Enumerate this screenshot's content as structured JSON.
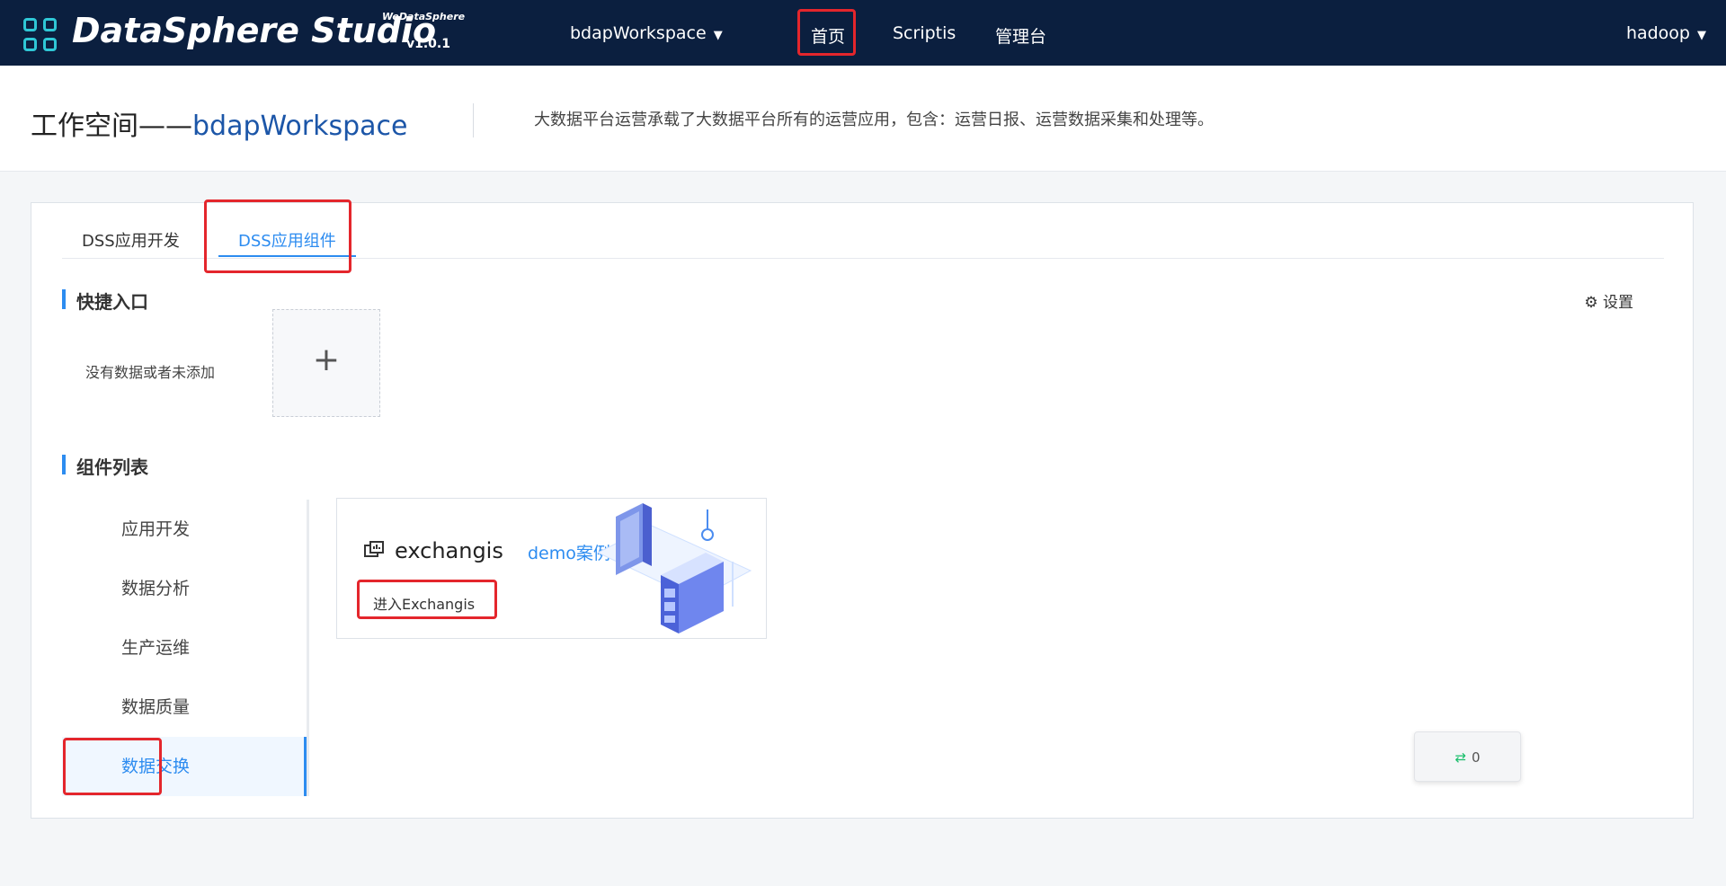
{
  "brand": {
    "name": "DataSphere Studio",
    "sub": "WeDataSphere",
    "version": "v1.0.1"
  },
  "topnav": {
    "workspace": "bdapWorkspace",
    "items": [
      "首页",
      "Scriptis",
      "管理台"
    ],
    "user": "hadoop"
  },
  "workspace_header": {
    "title_prefix": "工作空间——",
    "title_name": "bdapWorkspace",
    "description": "大数据平台运营承载了大数据平台所有的运营应用，包含：运营日报、运营数据采集和处理等。"
  },
  "tabs": [
    "DSS应用开发",
    "DSS应用组件"
  ],
  "quick_entry": {
    "title": "快捷入口",
    "settings_label": "设置",
    "empty_text": "没有数据或者未添加",
    "add_symbol": "+"
  },
  "component_list": {
    "title": "组件列表",
    "items": [
      "应用开发",
      "数据分析",
      "生产运维",
      "数据质量",
      "数据交换"
    ]
  },
  "card": {
    "title": "exchangis",
    "link": "demo案例",
    "enter_button": "进入Exchangis"
  },
  "float_widget": {
    "count": "0"
  },
  "colors": {
    "topbar": "#0b1f3f",
    "accent": "#2d8cf0",
    "highlight_box": "#e4262c"
  }
}
